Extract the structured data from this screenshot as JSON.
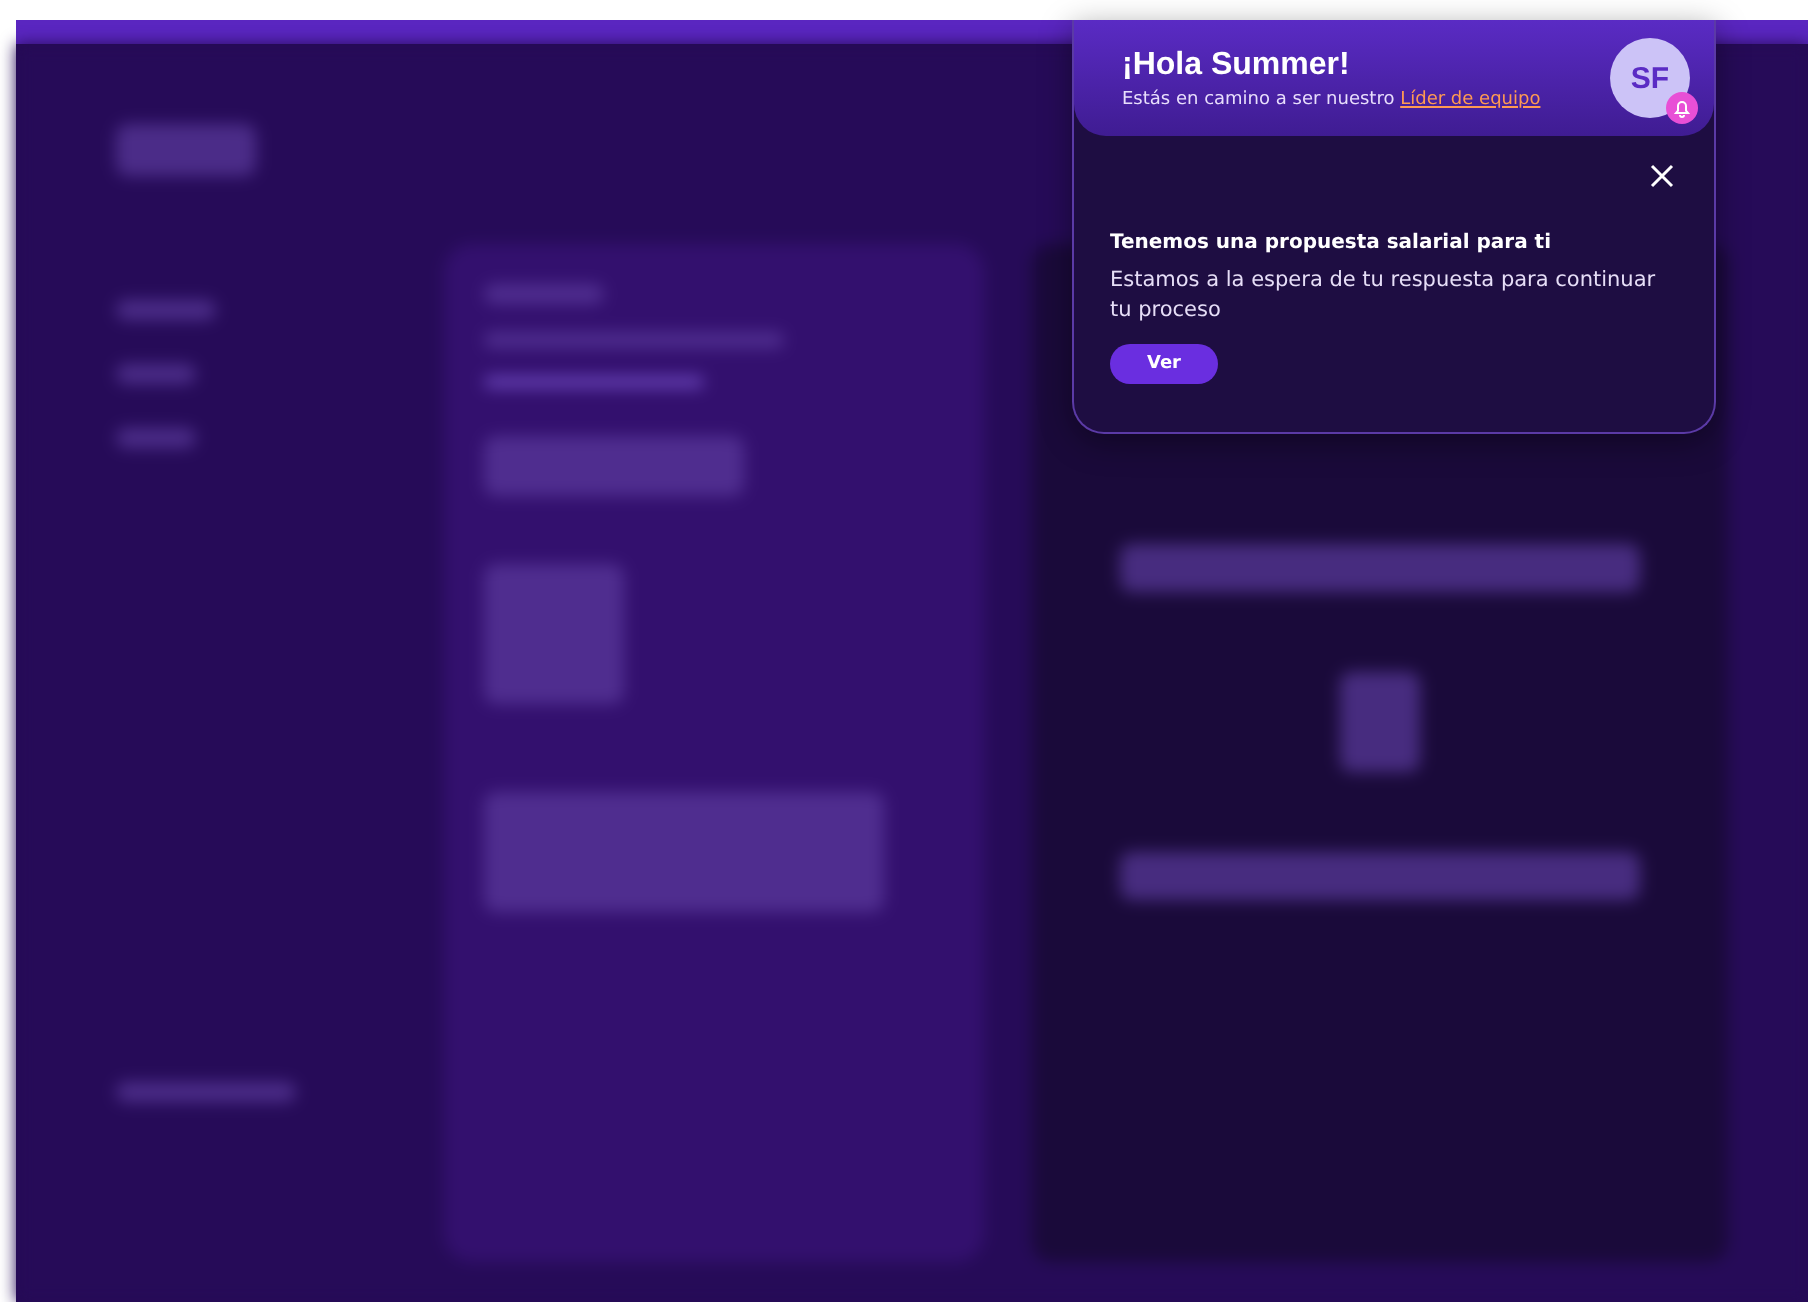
{
  "header": {
    "greeting": "¡Hola Summer!",
    "subtitle": "Estás en camino a ser nuestro",
    "subtitle_link": "Líder de equipo",
    "avatar_initials": "SF",
    "has_notification": true
  },
  "notification": {
    "title": "Tenemos una propuesta salarial para ti",
    "message": "Estamos a la espera de tu respuesta para continuar tu proceso",
    "button": "Ver"
  }
}
